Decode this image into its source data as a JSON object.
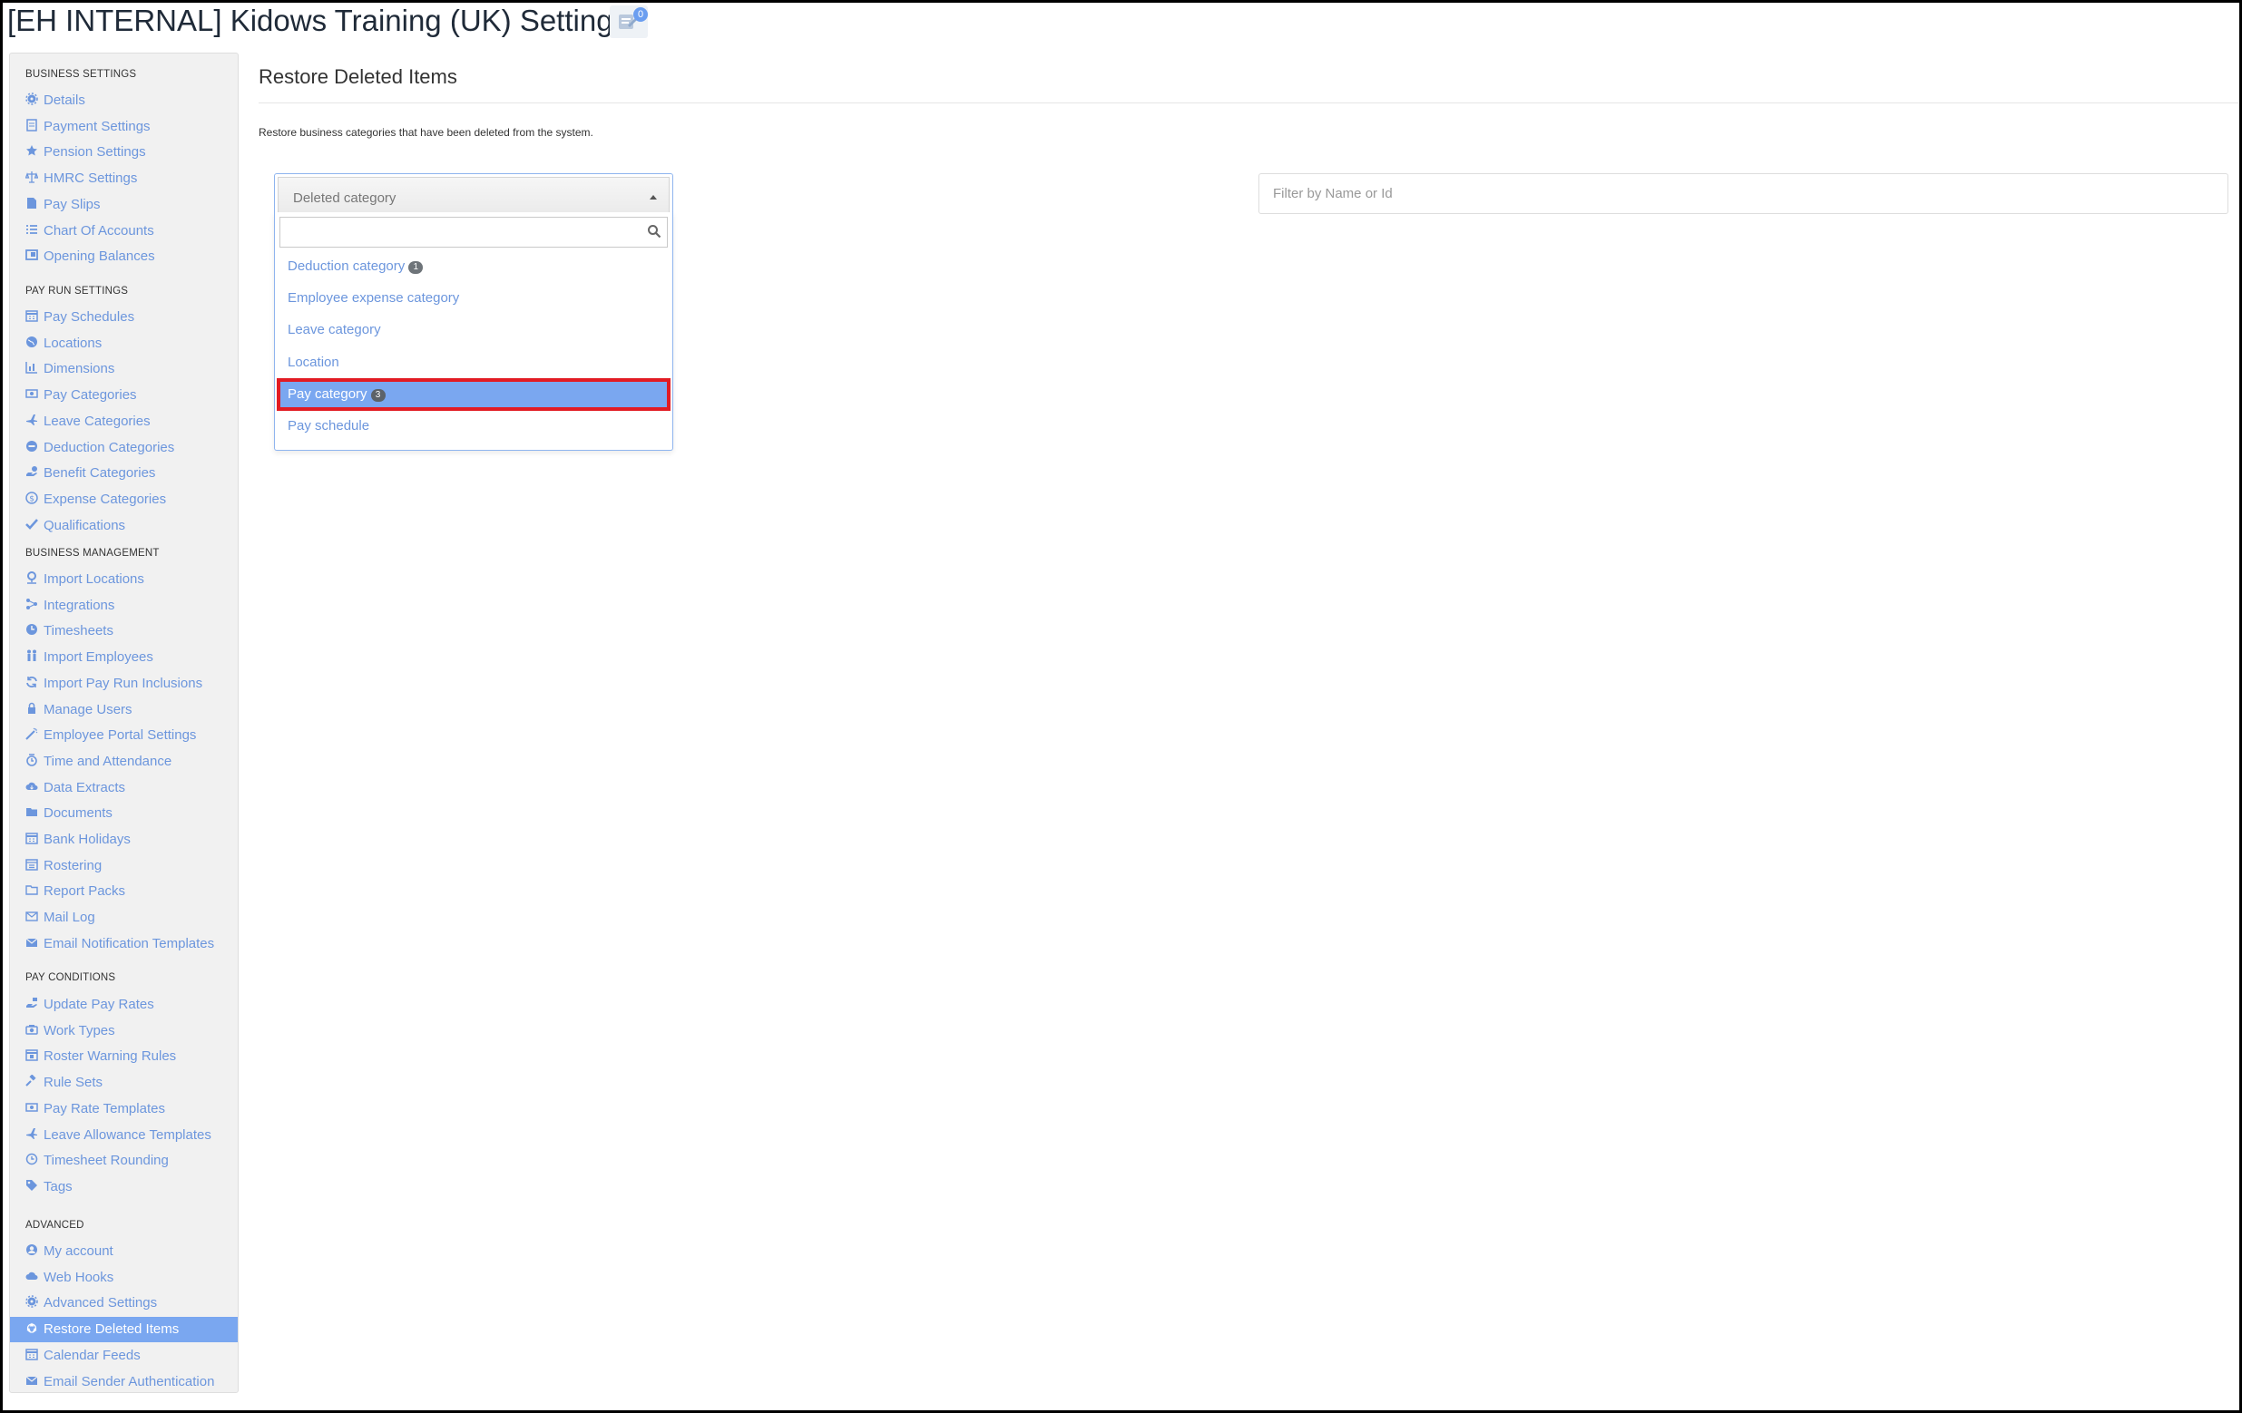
{
  "header": {
    "title": "[EH INTERNAL] Kidows Training (UK) Settings",
    "notification_count": "0"
  },
  "sidebar": {
    "sections": [
      {
        "title": "BUSINESS SETTINGS",
        "items": [
          {
            "label": "Details",
            "icon": "gear-icon"
          },
          {
            "label": "Payment Settings",
            "icon": "document-icon"
          },
          {
            "label": "Pension Settings",
            "icon": "star-icon"
          },
          {
            "label": "HMRC Settings",
            "icon": "scale-icon"
          },
          {
            "label": "Pay Slips",
            "icon": "file-icon"
          },
          {
            "label": "Chart Of Accounts",
            "icon": "list-icon"
          },
          {
            "label": "Opening Balances",
            "icon": "ledger-icon"
          }
        ]
      },
      {
        "title": "PAY RUN SETTINGS",
        "items": [
          {
            "label": "Pay Schedules",
            "icon": "calendar-icon"
          },
          {
            "label": "Locations",
            "icon": "globe-icon"
          },
          {
            "label": "Dimensions",
            "icon": "bar-chart-icon"
          },
          {
            "label": "Pay Categories",
            "icon": "money-icon"
          },
          {
            "label": "Leave Categories",
            "icon": "plane-icon"
          },
          {
            "label": "Deduction Categories",
            "icon": "minus-circle-icon"
          },
          {
            "label": "Benefit Categories",
            "icon": "benefit-icon"
          },
          {
            "label": "Expense Categories",
            "icon": "dollar-circle-icon"
          },
          {
            "label": "Qualifications",
            "icon": "check-icon"
          }
        ]
      },
      {
        "title": "BUSINESS MANAGEMENT",
        "items": [
          {
            "label": "Import Locations",
            "icon": "map-pin-icon"
          },
          {
            "label": "Integrations",
            "icon": "integration-icon"
          },
          {
            "label": "Timesheets",
            "icon": "clock-icon"
          },
          {
            "label": "Import Employees",
            "icon": "people-icon"
          },
          {
            "label": "Import Pay Run Inclusions",
            "icon": "refresh-icon"
          },
          {
            "label": "Manage Users",
            "icon": "lock-icon"
          },
          {
            "label": "Employee Portal Settings",
            "icon": "wand-icon"
          },
          {
            "label": "Time and Attendance",
            "icon": "time-icon"
          },
          {
            "label": "Data Extracts",
            "icon": "cloud-download-icon"
          },
          {
            "label": "Documents",
            "icon": "folder-icon"
          },
          {
            "label": "Bank Holidays",
            "icon": "calendar-icon"
          },
          {
            "label": "Rostering",
            "icon": "roster-icon"
          },
          {
            "label": "Report Packs",
            "icon": "folder-open-icon"
          },
          {
            "label": "Mail Log",
            "icon": "envelope-open-icon"
          },
          {
            "label": "Email Notification Templates",
            "icon": "envelope-icon"
          }
        ]
      },
      {
        "title": "PAY CONDITIONS",
        "items": [
          {
            "label": "Update Pay Rates",
            "icon": "hand-money-icon"
          },
          {
            "label": "Work Types",
            "icon": "camera-icon"
          },
          {
            "label": "Roster Warning Rules",
            "icon": "calendar-warning-icon"
          },
          {
            "label": "Rule Sets",
            "icon": "gavel-icon"
          },
          {
            "label": "Pay Rate Templates",
            "icon": "money-icon"
          },
          {
            "label": "Leave Allowance Templates",
            "icon": "plane-icon"
          },
          {
            "label": "Timesheet Rounding",
            "icon": "clock-outline-icon"
          },
          {
            "label": "Tags",
            "icon": "tag-icon"
          }
        ]
      },
      {
        "title": "ADVANCED",
        "items": [
          {
            "label": "My account",
            "icon": "user-circle-icon"
          },
          {
            "label": "Web Hooks",
            "icon": "cloud-icon"
          },
          {
            "label": "Advanced Settings",
            "icon": "gear-icon"
          },
          {
            "label": "Restore Deleted Items",
            "icon": "recycle-icon",
            "active": true
          },
          {
            "label": "Calendar Feeds",
            "icon": "calendar-icon"
          },
          {
            "label": "Email Sender Authentication",
            "icon": "envelope-icon"
          }
        ]
      }
    ]
  },
  "main": {
    "title": "Restore Deleted Items",
    "description": "Restore business categories that have been deleted from the system.",
    "category_select": {
      "placeholder": "Deleted category",
      "search_value": "",
      "options": [
        {
          "label": "Deduction category",
          "count": "1"
        },
        {
          "label": "Employee expense category",
          "count": ""
        },
        {
          "label": "Leave category",
          "count": ""
        },
        {
          "label": "Location",
          "count": ""
        },
        {
          "label": "Pay category",
          "count": "3",
          "highlighted": true
        },
        {
          "label": "Pay schedule",
          "count": ""
        }
      ]
    },
    "filter": {
      "placeholder": "Filter by Name or Id",
      "value": ""
    }
  },
  "colors": {
    "link": "#6c96dd",
    "active_bg": "#7aa7f0",
    "highlight_outline": "#e21b23"
  }
}
